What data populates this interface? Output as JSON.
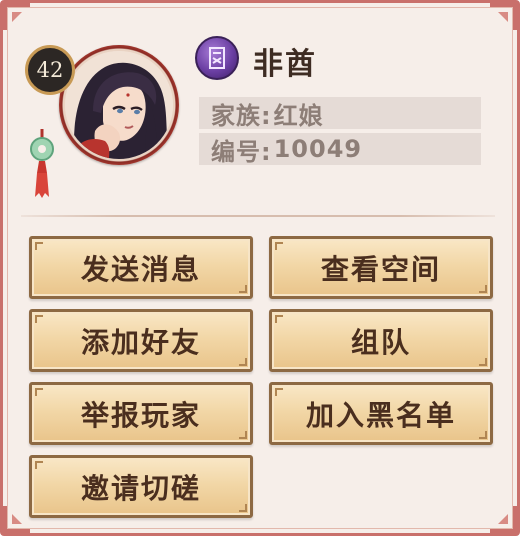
{
  "player": {
    "level": "42",
    "name": "非酋",
    "family_label": "家族:",
    "family_value": "红娘",
    "id_label": "编号:",
    "id_value": "10049",
    "class_icon": "purple-class-emblem-icon"
  },
  "actions": [
    {
      "label": "发送消息"
    },
    {
      "label": "查看空间"
    },
    {
      "label": "添加好友"
    },
    {
      "label": "组队"
    },
    {
      "label": "举报玩家"
    },
    {
      "label": "加入黑名单"
    },
    {
      "label": "邀请切磋"
    }
  ],
  "colors": {
    "panel_background": "#f6eee9",
    "panel_border": "#c9706b",
    "button_fill": "#f2d7a7",
    "button_border": "#8d6943",
    "button_text": "#4a2e1e",
    "info_row_background": "#e5dbd6",
    "info_text": "#8d7e77"
  }
}
